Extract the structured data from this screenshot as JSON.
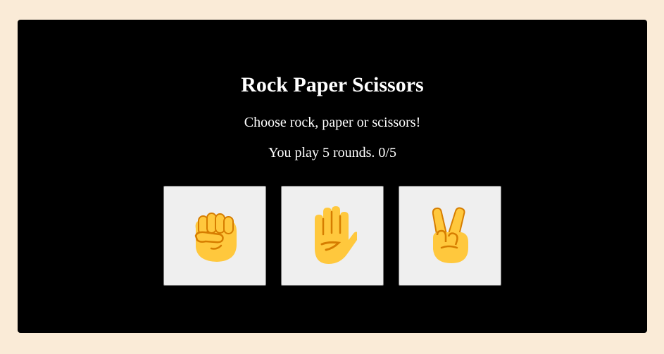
{
  "game": {
    "title": "Rock Paper Scissors",
    "instruction": "Choose rock, paper or scissors!",
    "rounds_text": "You play 5 rounds. 0/5"
  },
  "choices": [
    {
      "name": "rock",
      "icon": "raised-fist-icon"
    },
    {
      "name": "paper",
      "icon": "raised-hand-icon"
    },
    {
      "name": "scissors",
      "icon": "victory-hand-icon"
    }
  ],
  "colors": {
    "page_background": "#faebd7",
    "panel_background": "#000000",
    "text": "#ffffff",
    "button_background": "#efefef",
    "emoji_skin": "#ffc83d",
    "emoji_shade": "#d67d00"
  }
}
